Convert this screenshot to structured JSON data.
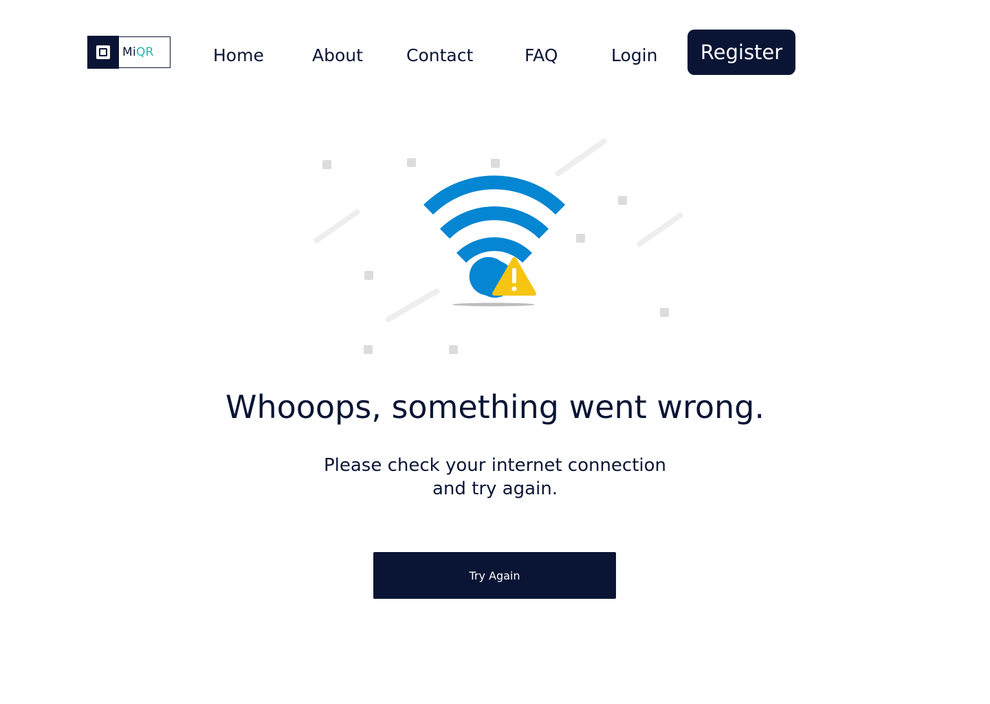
{
  "logo": {
    "text_prefix": "Mi",
    "text_suffix": "QR",
    "brand_color": "#0a1535",
    "accent_color": "#1fb8b0"
  },
  "nav": {
    "items": [
      {
        "label": "Home"
      },
      {
        "label": "About"
      },
      {
        "label": "Contact"
      },
      {
        "label": "FAQ"
      },
      {
        "label": "Login"
      }
    ],
    "register_label": "Register"
  },
  "illustration": {
    "icon": "wifi-warning-icon",
    "wifi_color": "#0486d2",
    "warning_color": "#f6c511"
  },
  "error": {
    "headline": "Whooops, something went wrong.",
    "message_line1": "Please check your internet connection",
    "message_line2": "and try again.",
    "button_label": "Try Again"
  }
}
